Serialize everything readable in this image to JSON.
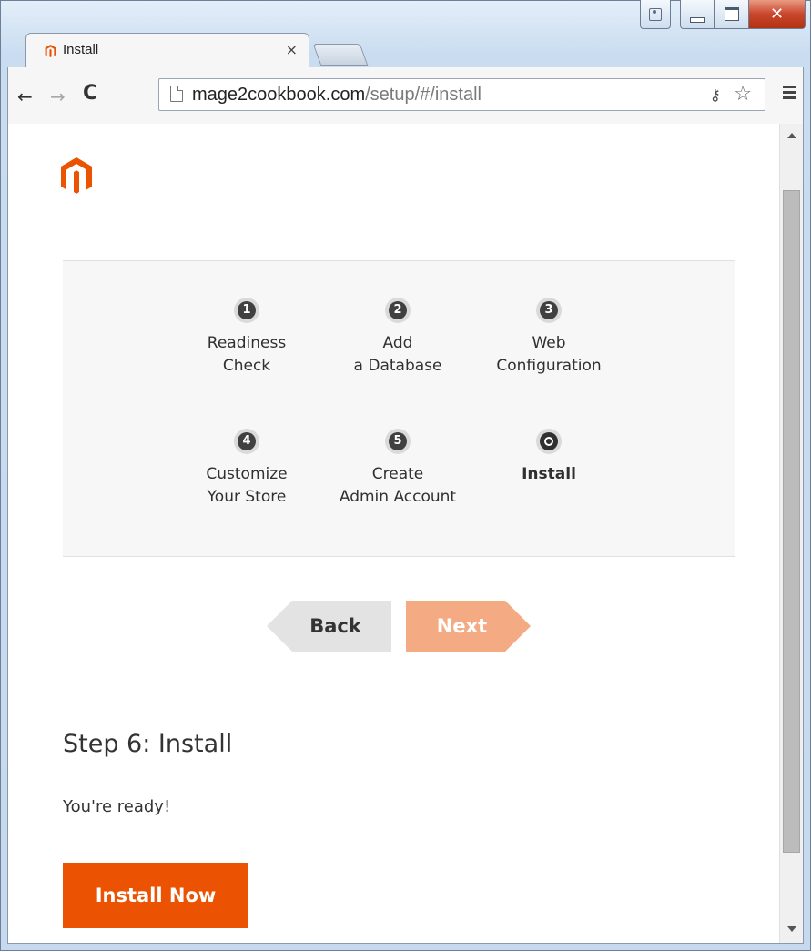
{
  "tab": {
    "title": "Install",
    "close_glyph": "×"
  },
  "address_bar": {
    "host": "mage2cookbook.com",
    "path": "/setup/#/install"
  },
  "icons": {
    "favicon": "magento-favicon-icon",
    "back": "back-arrow-icon",
    "forward": "forward-arrow-icon",
    "reload": "reload-icon",
    "page": "page-icon",
    "key": "key-icon",
    "star": "bookmark-star-icon",
    "menu": "menu-icon"
  },
  "brand_color": "#eb5202",
  "steps": [
    {
      "number": "1",
      "line1": "Readiness",
      "line2": "Check",
      "active": false
    },
    {
      "number": "2",
      "line1": "Add",
      "line2": "a Database",
      "active": false
    },
    {
      "number": "3",
      "line1": "Web",
      "line2": "Configuration",
      "active": false
    },
    {
      "number": "4",
      "line1": "Customize",
      "line2": "Your Store",
      "active": false
    },
    {
      "number": "5",
      "line1": "Create",
      "line2": "Admin Account",
      "active": false
    },
    {
      "number": "",
      "line1": "Install",
      "line2": "",
      "active": true
    }
  ],
  "nav": {
    "back_label": "Back",
    "next_label": "Next"
  },
  "content": {
    "step_title": "Step 6: Install",
    "ready_text": "You're ready!",
    "install_button": "Install Now"
  }
}
